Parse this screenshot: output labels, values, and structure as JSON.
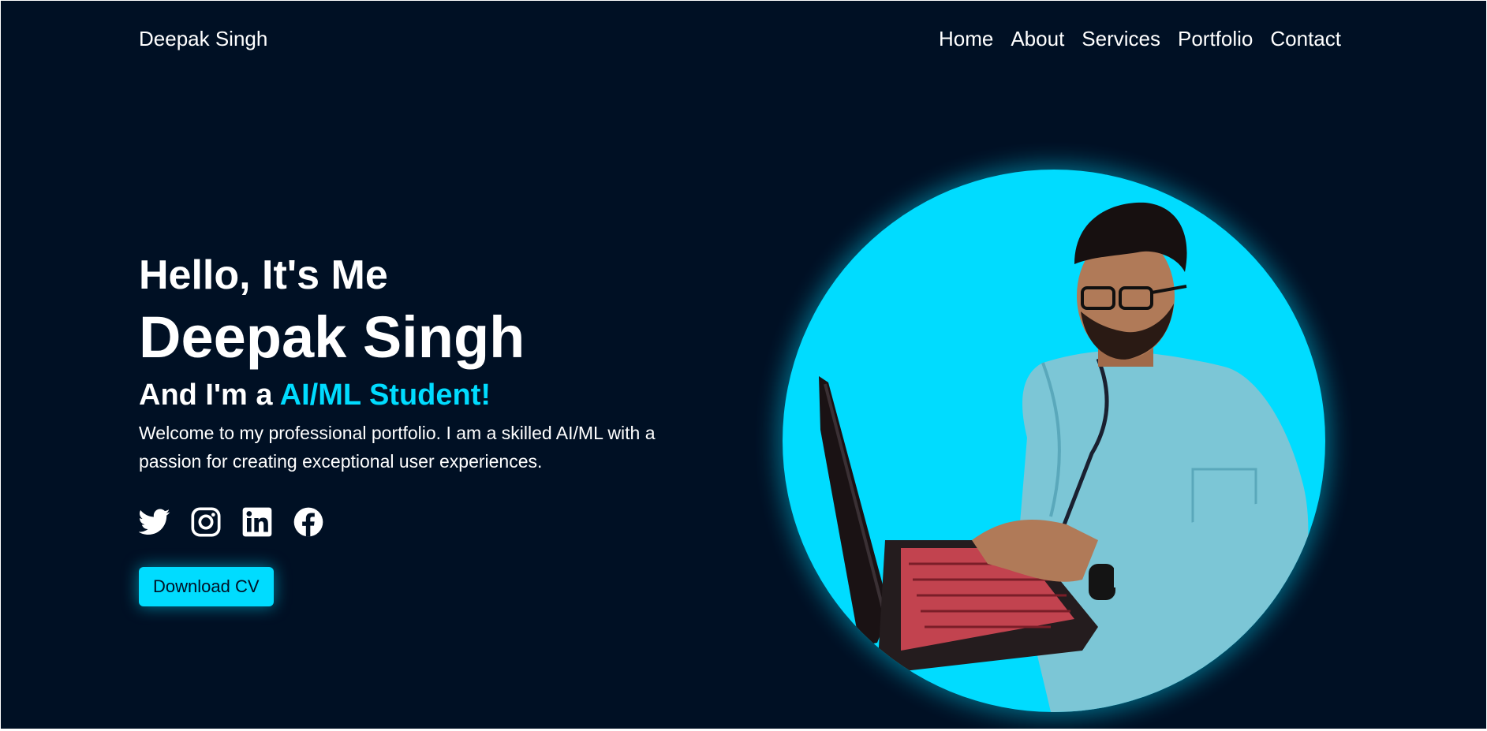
{
  "header": {
    "logo": "Deepak Singh",
    "nav": [
      "Home",
      "About",
      "Services",
      "Portfolio",
      "Contact"
    ]
  },
  "hero": {
    "greeting": "Hello, It's Me",
    "name": "Deepak Singh",
    "role_prefix": "And I'm a ",
    "role_highlight": "AI/ML Student!",
    "intro": "Welcome to my professional portfolio. I am a skilled AI/ML with a passion for creating exceptional user experiences.",
    "socials": [
      {
        "icon": "twitter-icon"
      },
      {
        "icon": "instagram-icon"
      },
      {
        "icon": "linkedin-icon"
      },
      {
        "icon": "facebook-icon"
      }
    ],
    "cv_button": "Download CV",
    "portrait_icon": "person-with-laptop-photo"
  },
  "colors": {
    "background": "#001024",
    "accent": "#00dcff",
    "text": "#ffffff"
  }
}
